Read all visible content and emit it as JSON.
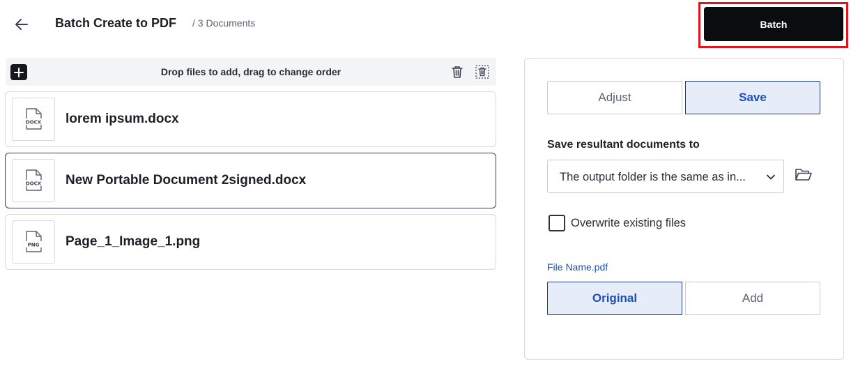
{
  "header": {
    "title": "Batch Create to PDF",
    "subtitle": "/ 3 Documents",
    "batch_label": "Batch"
  },
  "dropbar": {
    "text": "Drop files to add, drag to change order"
  },
  "files": [
    {
      "name": "lorem ipsum.docx",
      "type": "DOCX"
    },
    {
      "name": "New Portable Document 2signed.docx",
      "type": "DOCX"
    },
    {
      "name": "Page_1_Image_1.png",
      "type": "PNG"
    }
  ],
  "settings": {
    "tabs": [
      "Adjust",
      "Save"
    ],
    "active_tab": "Save",
    "save_to_label": "Save resultant documents to",
    "folder_select_value": "The output folder is the same as in...",
    "overwrite_label": "Overwrite existing files",
    "overwrite_checked": false,
    "filename_label": "File Name.pdf",
    "filename_options": [
      "Original",
      "Add"
    ],
    "filename_active": "Original"
  },
  "colors": {
    "accent": "#1c4fb8",
    "highlight": "#e0141c",
    "batch_bg": "#0b0c0f"
  }
}
